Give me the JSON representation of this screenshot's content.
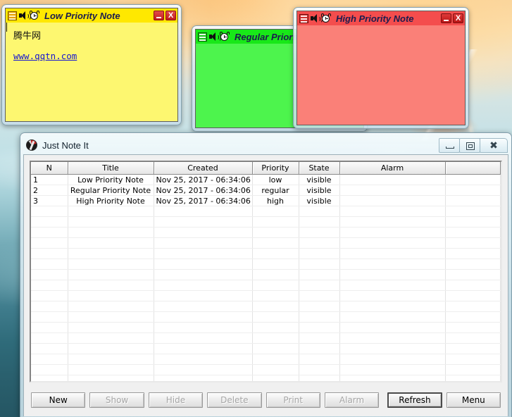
{
  "notes": [
    {
      "id": "low",
      "title": "Low Priority Note",
      "icons": {
        "menu": "hamburger-menu-icon",
        "sound": "speaker-icon",
        "alarm": "alarm-clock-icon"
      },
      "controls": {
        "minimize": "minimize-button",
        "close": "close-button",
        "close_label": "X"
      },
      "body_text": "腾牛网",
      "body_link": "www.qqtn.com",
      "color": "#fdf770",
      "title_color": "#ffe800"
    },
    {
      "id": "regular",
      "title": "Regular Priority Note",
      "icons": {
        "menu": "hamburger-menu-icon",
        "sound": "speaker-icon",
        "alarm": "alarm-clock-icon"
      },
      "color": "#4df44d",
      "title_color": "#18e818"
    },
    {
      "id": "high",
      "title": "High Priority Note",
      "icons": {
        "menu": "hamburger-menu-icon",
        "sound": "speaker-icon",
        "alarm": "alarm-clock-icon"
      },
      "controls": {
        "minimize": "minimize-button",
        "close": "close-button",
        "close_label": "X"
      },
      "color": "#fa8078",
      "title_color": "#f44d4d"
    }
  ],
  "app": {
    "title": "Just Note It",
    "icon": "app-icon",
    "window_controls": {
      "minimize": "minimize",
      "maximize": "restore",
      "close_label": "✖"
    },
    "table": {
      "headers": [
        "N",
        "Title",
        "Created",
        "Priority",
        "State",
        "Alarm",
        ""
      ],
      "rows": [
        {
          "n": "1",
          "title": "Low Priority Note",
          "created": "Nov 25, 2017 - 06:34:06 ...",
          "priority": "low",
          "state": "visible",
          "alarm": "",
          "extra": ""
        },
        {
          "n": "2",
          "title": "Regular Priority Note",
          "created": "Nov 25, 2017 - 06:34:06 ...",
          "priority": "regular",
          "state": "visible",
          "alarm": "",
          "extra": ""
        },
        {
          "n": "3",
          "title": "High Priority Note",
          "created": "Nov 25, 2017 - 06:34:06 ...",
          "priority": "high",
          "state": "visible",
          "alarm": "",
          "extra": ""
        }
      ],
      "empty_row_count": 19
    },
    "buttons": [
      {
        "label": "New",
        "enabled": true,
        "focused": false
      },
      {
        "label": "Show",
        "enabled": false,
        "focused": false
      },
      {
        "label": "Hide",
        "enabled": false,
        "focused": false
      },
      {
        "label": "Delete",
        "enabled": false,
        "focused": false
      },
      {
        "label": "Print",
        "enabled": false,
        "focused": false
      },
      {
        "label": "Alarm",
        "enabled": false,
        "focused": false
      },
      {
        "label": "Refresh",
        "enabled": true,
        "focused": true
      },
      {
        "label": "Menu",
        "enabled": true,
        "focused": false
      }
    ]
  }
}
